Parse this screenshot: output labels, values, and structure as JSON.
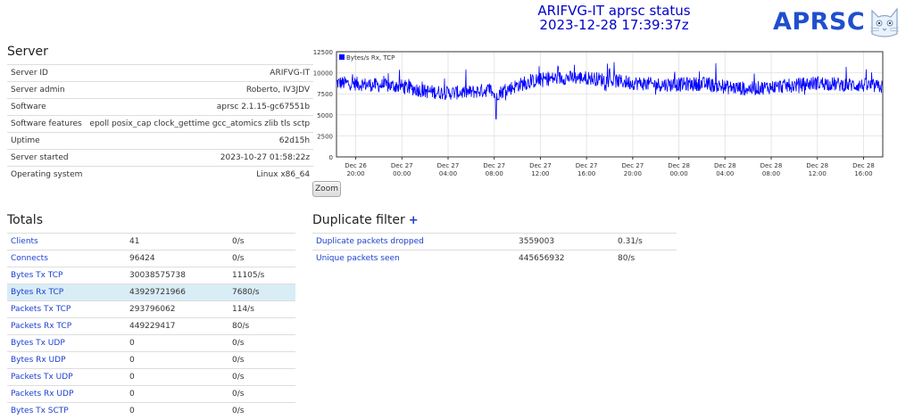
{
  "header": {
    "title_line1": "ARIFVG-IT aprsc status",
    "title_line2": "2023-12-28 17:39:37z",
    "logo_text": "APRSC"
  },
  "server": {
    "heading": "Server",
    "rows": [
      {
        "label": "Server ID",
        "value": "ARIFVG-IT"
      },
      {
        "label": "Server admin",
        "value": "Roberto, IV3JDV"
      },
      {
        "label": "Software",
        "value": "aprsc 2.1.15-gc67551b"
      },
      {
        "label": "Software features",
        "value": "epoll posix_cap clock_gettime gcc_atomics zlib tls sctp"
      },
      {
        "label": "Uptime",
        "value": "62d15h"
      },
      {
        "label": "Server started",
        "value": "2023-10-27 01:58:22z"
      },
      {
        "label": "Operating system",
        "value": "Linux x86_64"
      }
    ]
  },
  "chart_data": {
    "type": "line",
    "legend": "Bytes/s Rx, TCP",
    "series": [
      {
        "name": "Bytes/s Rx, TCP",
        "color": "#0000ff"
      }
    ],
    "ylim": [
      0,
      12500
    ],
    "yticks": [
      "12500",
      "10000",
      "7500",
      "5000",
      "2500",
      "0"
    ],
    "xticks": [
      {
        "date": "Dec 26",
        "time": "20:00"
      },
      {
        "date": "Dec 27",
        "time": "00:00"
      },
      {
        "date": "Dec 27",
        "time": "04:00"
      },
      {
        "date": "Dec 27",
        "time": "08:00"
      },
      {
        "date": "Dec 27",
        "time": "12:00"
      },
      {
        "date": "Dec 27",
        "time": "16:00"
      },
      {
        "date": "Dec 27",
        "time": "20:00"
      },
      {
        "date": "Dec 28",
        "time": "00:00"
      },
      {
        "date": "Dec 28",
        "time": "04:00"
      },
      {
        "date": "Dec 28",
        "time": "08:00"
      },
      {
        "date": "Dec 28",
        "time": "12:00"
      },
      {
        "date": "Dec 28",
        "time": "16:00"
      }
    ],
    "x_start": "2023-12-26 18:20",
    "x_end": "2023-12-28 17:40",
    "profile": [
      [
        "2023-12-26 18:20",
        8800
      ],
      [
        "2023-12-26 20:00",
        8700
      ],
      [
        "2023-12-26 22:00",
        8500
      ],
      [
        "2023-12-27 00:00",
        8400
      ],
      [
        "2023-12-27 02:00",
        7800
      ],
      [
        "2023-12-27 04:00",
        7600
      ],
      [
        "2023-12-27 06:00",
        7700
      ],
      [
        "2023-12-27 07:40",
        8000
      ],
      [
        "2023-12-27 08:00",
        7400
      ],
      [
        "2023-12-27 10:00",
        8500
      ],
      [
        "2023-12-27 12:00",
        9200
      ],
      [
        "2023-12-27 14:00",
        9400
      ],
      [
        "2023-12-27 16:00",
        9400
      ],
      [
        "2023-12-27 18:00",
        9100
      ],
      [
        "2023-12-27 20:00",
        8800
      ],
      [
        "2023-12-27 22:00",
        8600
      ],
      [
        "2023-12-28 00:00",
        8600
      ],
      [
        "2023-12-28 02:00",
        8700
      ],
      [
        "2023-12-28 04:00",
        8300
      ],
      [
        "2023-12-28 06:00",
        8100
      ],
      [
        "2023-12-28 08:00",
        8300
      ],
      [
        "2023-12-28 10:00",
        8500
      ],
      [
        "2023-12-28 12:00",
        8800
      ],
      [
        "2023-12-28 14:00",
        8600
      ],
      [
        "2023-12-28 16:00",
        8500
      ],
      [
        "2023-12-28 17:40",
        8300
      ]
    ],
    "min_point": [
      "2023-12-27 08:10",
      4500
    ],
    "zoom_label": "Zoom"
  },
  "totals": {
    "heading": "Totals",
    "rows": [
      {
        "label": "Clients",
        "value": "41",
        "rate": "0/s"
      },
      {
        "label": "Connects",
        "value": "96424",
        "rate": "0/s"
      },
      {
        "label": "Bytes Tx TCP",
        "value": "30038575738",
        "rate": "11105/s"
      },
      {
        "label": "Bytes Rx TCP",
        "value": "43929721966",
        "rate": "7680/s"
      },
      {
        "label": "Packets Tx TCP",
        "value": "293796062",
        "rate": "114/s"
      },
      {
        "label": "Packets Rx TCP",
        "value": "449229417",
        "rate": "80/s"
      },
      {
        "label": "Bytes Tx UDP",
        "value": "0",
        "rate": "0/s"
      },
      {
        "label": "Bytes Rx UDP",
        "value": "0",
        "rate": "0/s"
      },
      {
        "label": "Packets Tx UDP",
        "value": "0",
        "rate": "0/s"
      },
      {
        "label": "Packets Rx UDP",
        "value": "0",
        "rate": "0/s"
      },
      {
        "label": "Bytes Tx SCTP",
        "value": "0",
        "rate": "0/s"
      }
    ]
  },
  "dupfilter": {
    "heading": "Duplicate filter",
    "plus": "+",
    "rows": [
      {
        "label": "Duplicate packets dropped",
        "value": "3559003",
        "rate": "0.31/s"
      },
      {
        "label": "Unique packets seen",
        "value": "445656932",
        "rate": "80/s"
      }
    ]
  }
}
